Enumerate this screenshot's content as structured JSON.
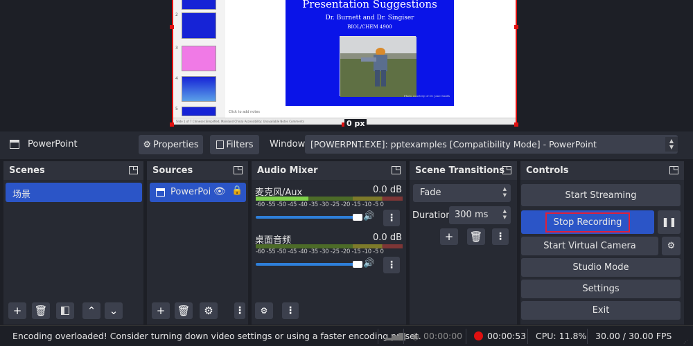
{
  "preview": {
    "slide_title": "Presentation Suggestions",
    "slide_authors": "Dr. Burnett and Dr. Singiser",
    "slide_course": "BIOL/CHEM 4900",
    "slide_caption": "Photo courtesy of Dr. Jane Smith",
    "notes_placeholder": "Click to add notes",
    "ppt_status": "Slide 1 of 7   Chinese (Simplified, Mainland China)   Accessibility: Unavailable        Notes   Comments",
    "thumb_numbers": [
      "2",
      "3",
      "4",
      "5"
    ],
    "size_label": "0 px"
  },
  "sourcebar": {
    "source_name": "PowerPoint",
    "properties_label": "Properties",
    "filters_label": "Filters",
    "window_label": "Window",
    "window_value": "[POWERPNT.EXE]: pptexamples [Compatibility Mode] - PowerPoint"
  },
  "scenes": {
    "title": "Scenes",
    "items": [
      "场景"
    ]
  },
  "sources": {
    "title": "Sources",
    "items": [
      "PowerPoi"
    ]
  },
  "audio": {
    "title": "Audio Mixer",
    "channels": [
      {
        "name": "麦克风/Aux",
        "db": "0.0 dB",
        "level": 0.36
      },
      {
        "name": "桌面音频",
        "db": "0.0 dB",
        "level": 0
      }
    ],
    "ticks": "-60 -55 -50 -45 -40 -35 -30 -25 -20 -15 -10  -5   0"
  },
  "transitions": {
    "title": "Scene Transitions",
    "type": "Fade",
    "duration_label": "Duration",
    "duration_value": "300 ms"
  },
  "controls": {
    "title": "Controls",
    "start_streaming": "Start Streaming",
    "stop_recording": "Stop Recording",
    "start_virtual_camera": "Start Virtual Camera",
    "studio_mode": "Studio Mode",
    "settings": "Settings",
    "exit": "Exit"
  },
  "status": {
    "message": "Encoding overloaded! Consider turning down video settings or using a faster encoding preset.",
    "stream_time": "00:00:00",
    "rec_time": "00:00:53",
    "cpu": "CPU: 11.8%",
    "fps": "30.00 / 30.00 FPS"
  },
  "colors": {
    "accent": "#2b55c7",
    "highlight_border": "#e0203a",
    "record_dot": "#e01010"
  }
}
